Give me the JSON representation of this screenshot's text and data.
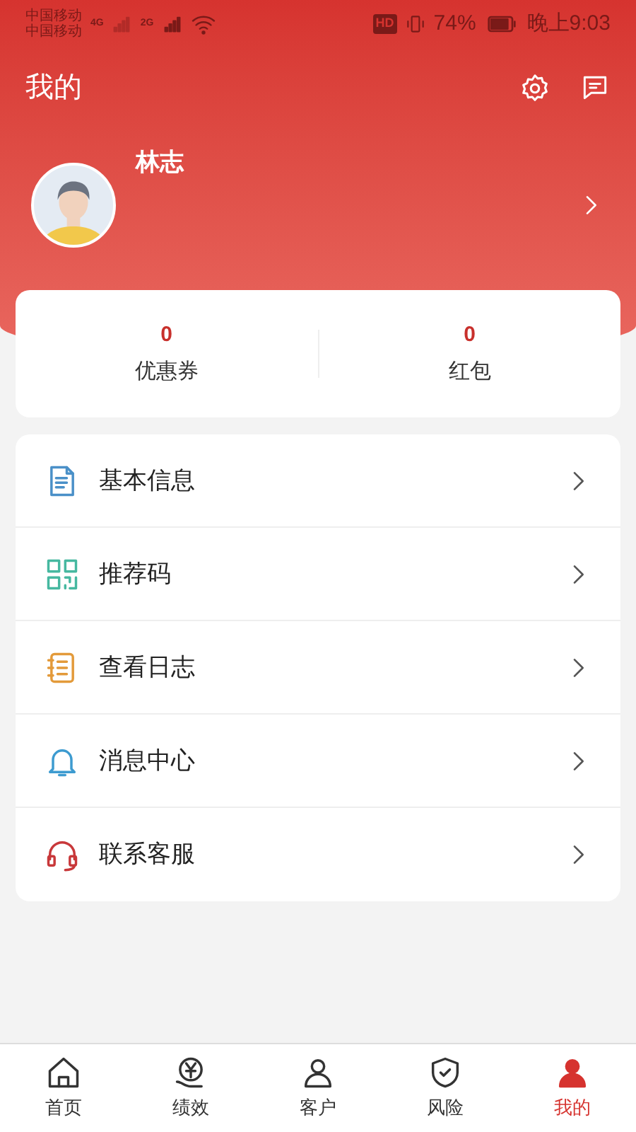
{
  "status_bar": {
    "carriers": [
      {
        "name": "中国移动",
        "network": "4G"
      },
      {
        "name": "中国移动",
        "network": "2G"
      }
    ],
    "hd": "HD",
    "battery": "74%",
    "time": "晚上9:03"
  },
  "header": {
    "title": "我的"
  },
  "profile": {
    "name": "林志"
  },
  "stats": [
    {
      "value": "0",
      "label": "优惠券"
    },
    {
      "value": "0",
      "label": "红包"
    }
  ],
  "menu": [
    {
      "kind": "document",
      "label": "基本信息",
      "color": "#4a90c8"
    },
    {
      "kind": "qr",
      "label": "推荐码",
      "color": "#46b8a0"
    },
    {
      "kind": "log",
      "label": "查看日志",
      "color": "#e39a3a"
    },
    {
      "kind": "bell",
      "label": "消息中心",
      "color": "#3d9bd0"
    },
    {
      "kind": "headset",
      "label": "联系客服",
      "color": "#c8383a"
    }
  ],
  "tab_bar": [
    {
      "kind": "home",
      "label": "首页",
      "selected": false
    },
    {
      "kind": "money",
      "label": "绩效",
      "selected": false
    },
    {
      "kind": "person",
      "label": "客户",
      "selected": false
    },
    {
      "kind": "shield",
      "label": "风险",
      "selected": false
    },
    {
      "kind": "me",
      "label": "我的",
      "selected": true
    }
  ]
}
